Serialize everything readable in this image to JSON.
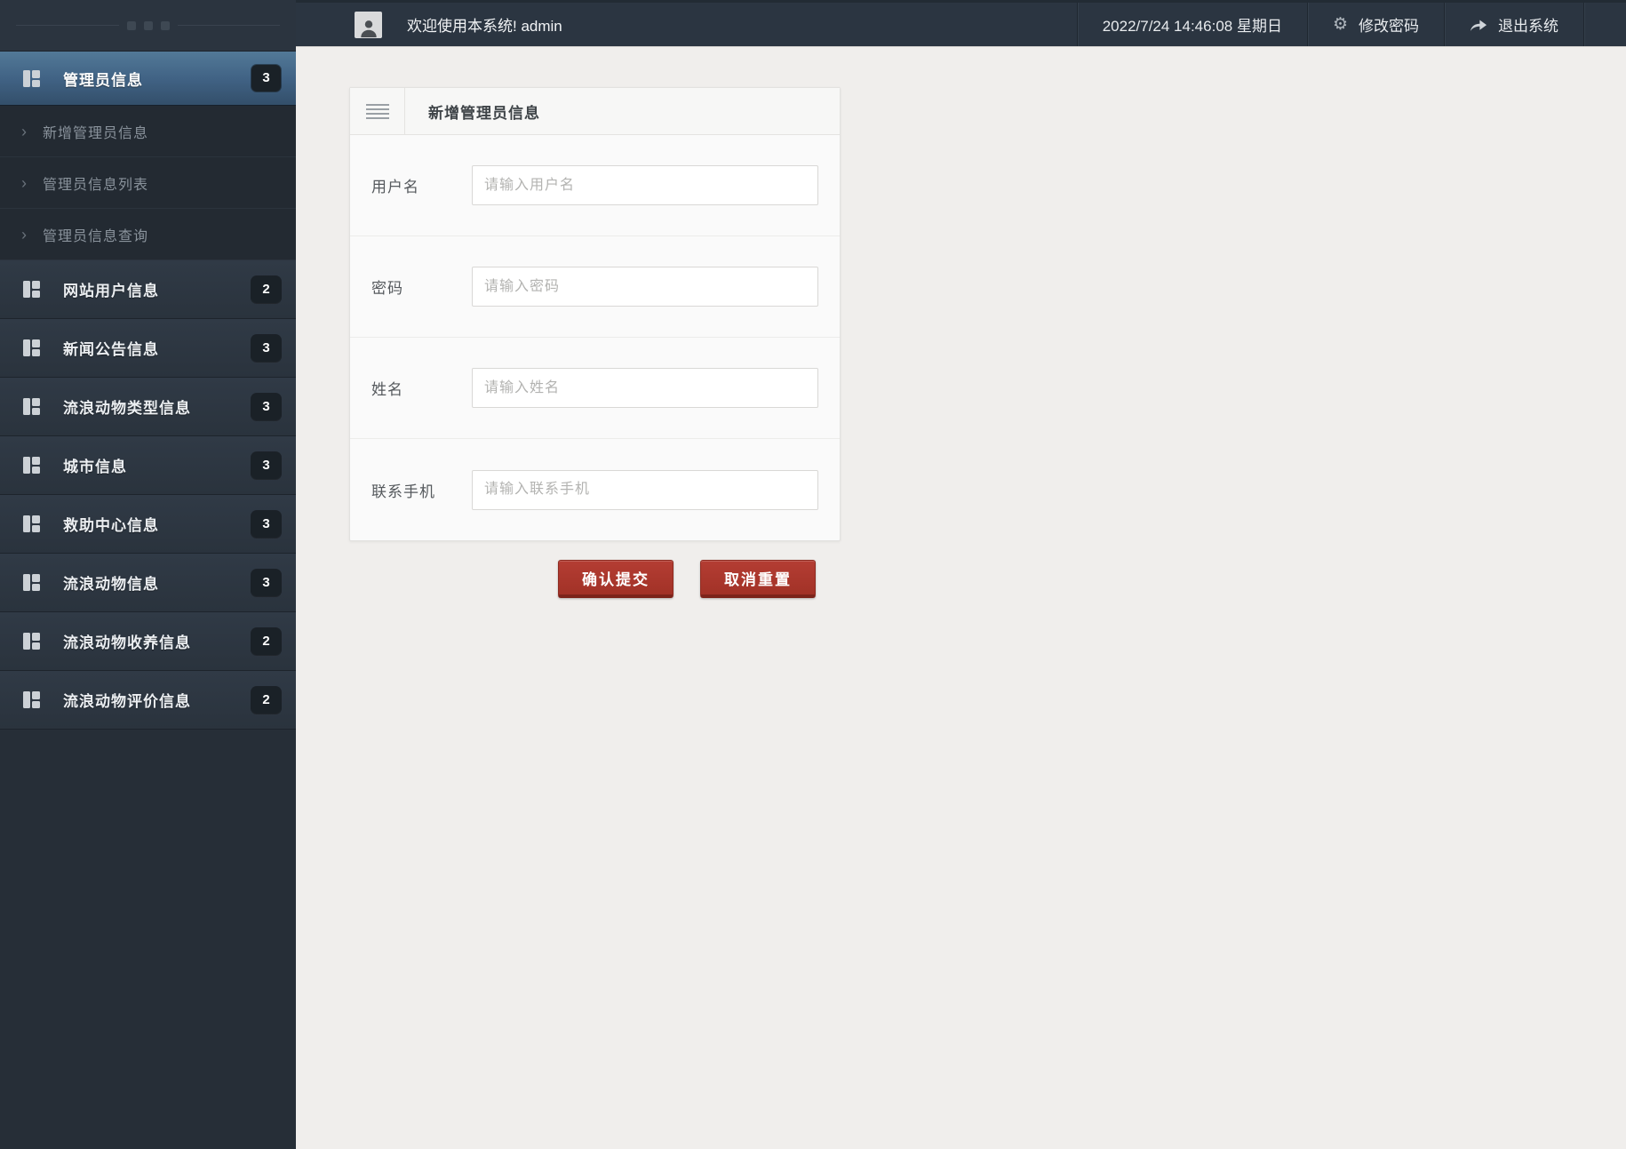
{
  "header": {
    "welcome_text": "欢迎使用本系统! admin",
    "datetime": "2022/7/24 14:46:08 星期日",
    "change_password_label": "修改密码",
    "logout_label": "退出系统"
  },
  "sidebar": {
    "items": [
      {
        "label": "管理员信息",
        "badge": "3",
        "active": true
      },
      {
        "label": "网站用户信息",
        "badge": "2"
      },
      {
        "label": "新闻公告信息",
        "badge": "3"
      },
      {
        "label": "流浪动物类型信息",
        "badge": "3"
      },
      {
        "label": "城市信息",
        "badge": "3"
      },
      {
        "label": "救助中心信息",
        "badge": "3"
      },
      {
        "label": "流浪动物信息",
        "badge": "3"
      },
      {
        "label": "流浪动物收养信息",
        "badge": "2"
      },
      {
        "label": "流浪动物评价信息",
        "badge": "2"
      }
    ],
    "submenu": [
      {
        "label": "新增管理员信息"
      },
      {
        "label": "管理员信息列表"
      },
      {
        "label": "管理员信息查询"
      }
    ],
    "submenu_chevron": "›"
  },
  "form": {
    "title": "新增管理员信息",
    "fields": [
      {
        "label": "用户名",
        "placeholder": "请输入用户名"
      },
      {
        "label": "密码",
        "placeholder": "请输入密码"
      },
      {
        "label": "姓名",
        "placeholder": "请输入姓名"
      },
      {
        "label": "联系手机",
        "placeholder": "请输入联系手机"
      }
    ],
    "buttons": {
      "submit": "确认提交",
      "reset": "取消重置"
    }
  },
  "icons": {
    "avatar": "person-silhouette",
    "change_password": "gear",
    "change_password_glyph": "⚙",
    "logout": "forward-curved-arrow",
    "menu_item": "grid-tiles",
    "submenu_item": "chevron-right",
    "panel_header": "hamburger-lines",
    "sidebar_top": "three-square-dots"
  },
  "colors": {
    "header_bg": "#2b3541",
    "sidebar_bg": "#262e37",
    "active_item_top": "#527997",
    "active_item_bottom": "#334f6a",
    "badge_bg": "#1a2127",
    "content_bg": "#f0eeec",
    "panel_bg": "#fafafa",
    "button_red_top": "#b43d33",
    "button_red_bottom": "#a23227",
    "button_red_border": "#7c241b"
  }
}
